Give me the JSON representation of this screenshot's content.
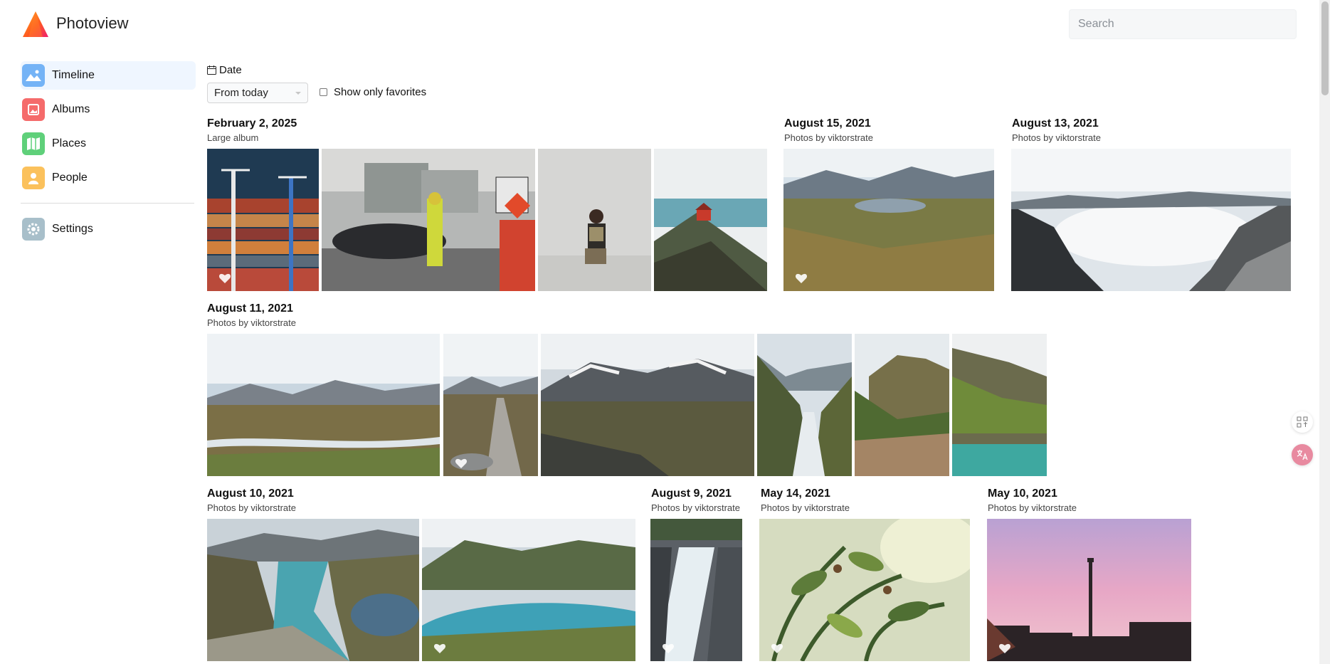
{
  "app": {
    "title": "Photoview"
  },
  "search": {
    "placeholder": "Search"
  },
  "sidebar": {
    "items": [
      {
        "label": "Timeline",
        "icon": "image-icon",
        "color": "#60a5fa",
        "active": true
      },
      {
        "label": "Albums",
        "icon": "album-icon",
        "color": "#f87171"
      },
      {
        "label": "Places",
        "icon": "map-icon",
        "color": "#4ade80"
      },
      {
        "label": "People",
        "icon": "person-icon",
        "color": "#fbbf24"
      },
      {
        "label": "Settings",
        "icon": "gear-icon",
        "color": "#9ca3af"
      }
    ]
  },
  "filters": {
    "date_label": "Date",
    "date_selected": "From today",
    "favorites_label": "Show only favorites",
    "favorites_checked": false
  },
  "groups": [
    {
      "date": "February 2, 2025",
      "subtitle": "Large album"
    },
    {
      "date": "August 15, 2021",
      "subtitle": "Photos by viktorstrate"
    },
    {
      "date": "August 13, 2021",
      "subtitle": "Photos by viktorstrate"
    },
    {
      "date": "August 11, 2021",
      "subtitle": "Photos by viktorstrate"
    },
    {
      "date": "August 10, 2021",
      "subtitle": "Photos by viktorstrate"
    },
    {
      "date": "August 9, 2021",
      "subtitle": "Photos by viktorstrate"
    },
    {
      "date": "May 14, 2021",
      "subtitle": "Photos by viktorstrate"
    },
    {
      "date": "May 10, 2021",
      "subtitle": "Photos by viktorstrate"
    }
  ],
  "photos": [
    {
      "subject": "shipping containers and cranes",
      "favorite_icon": true
    },
    {
      "subject": "traffic worker with stop sign"
    },
    {
      "subject": "woman seated portrait"
    },
    {
      "subject": "red cabin above fjord"
    },
    {
      "subject": "mountain lake valley",
      "favorite_icon": true
    },
    {
      "subject": "glacier and cloud sea"
    },
    {
      "subject": "river in snowy mountain plain"
    },
    {
      "subject": "trail by river",
      "favorite_icon": true
    },
    {
      "subject": "rocky mountain plateau"
    },
    {
      "subject": "waterfall stream"
    },
    {
      "subject": "rock cliff valley"
    },
    {
      "subject": "turquoise lake cliffs"
    },
    {
      "subject": "turquoise lake aerial view"
    },
    {
      "subject": "lake with mountains",
      "favorite_icon": true
    },
    {
      "subject": "rushing river water",
      "favorite_icon": true
    },
    {
      "subject": "green plant close-up",
      "favorite_icon": true
    },
    {
      "subject": "pink sunset chimney",
      "favorite_icon": true
    }
  ]
}
